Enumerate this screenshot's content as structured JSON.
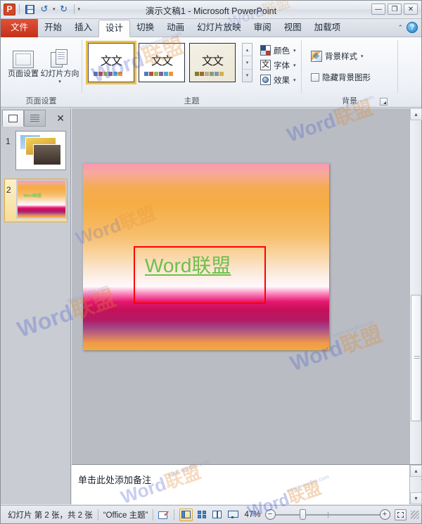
{
  "window": {
    "title": "演示文稿1  -  Microsoft PowerPoint",
    "minimize": "—",
    "maximize": "❐",
    "close": "✕"
  },
  "qat": {
    "logo": "P",
    "save_icon": "save-icon",
    "undo_icon": "undo-icon",
    "redo_icon": "redo-icon",
    "undo_caret": "▾",
    "customize_caret": "▾"
  },
  "tabs": [
    {
      "label": "文件",
      "type": "file"
    },
    {
      "label": "开始",
      "type": "normal"
    },
    {
      "label": "插入",
      "type": "normal"
    },
    {
      "label": "设计",
      "type": "active"
    },
    {
      "label": "切换",
      "type": "normal"
    },
    {
      "label": "动画",
      "type": "normal"
    },
    {
      "label": "幻灯片放映",
      "type": "normal"
    },
    {
      "label": "审阅",
      "type": "normal"
    },
    {
      "label": "视图",
      "type": "normal"
    },
    {
      "label": "加载项",
      "type": "normal"
    }
  ],
  "tab_right": {
    "collapse_caret": "⌃",
    "help": "?"
  },
  "ribbon": {
    "groups": [
      {
        "name": "page_setup",
        "label": "页面设置"
      },
      {
        "name": "themes",
        "label": "主题"
      },
      {
        "name": "background",
        "label": "背景"
      }
    ],
    "page_setup": {
      "buttons": [
        {
          "label": "页面设置",
          "icon": "page-setup-icon"
        },
        {
          "label": "幻灯片方向",
          "icon": "slide-orientation-icon",
          "caret": "▾"
        }
      ]
    },
    "themes": {
      "thumbnails": [
        {
          "text": "文文",
          "selected": true,
          "swatches": [
            "#4a7ebb",
            "#be4b48",
            "#98b954",
            "#7d60a0",
            "#4bacc6",
            "#f0933a"
          ]
        },
        {
          "text": "文文",
          "selected": false,
          "swatches": [
            "#4a7ebb",
            "#be4b48",
            "#98b954",
            "#7d60a0",
            "#4bacc6",
            "#f0933a"
          ]
        },
        {
          "text": "文文",
          "selected": false,
          "swatches": [
            "#837c2c",
            "#9c6a2f",
            "#b8ae8a",
            "#8f9a72",
            "#7f9aa8",
            "#d2b14a"
          ]
        }
      ],
      "scroll_up": "▴",
      "scroll_down": "▾",
      "more": "▾",
      "side_buttons": [
        {
          "label": "颜色",
          "icon": "theme-colors-icon",
          "caret": "▾"
        },
        {
          "label": "字体",
          "icon": "theme-fonts-icon",
          "glyph": "文",
          "caret": "▾"
        },
        {
          "label": "效果",
          "icon": "theme-effects-icon",
          "caret": "▾"
        }
      ]
    },
    "background": {
      "style_button": {
        "label": "背景样式",
        "icon": "background-styles-icon",
        "caret": "▾"
      },
      "hide_graphics": {
        "label": "隐藏背景图形",
        "checked": false
      },
      "launcher": "dialog-launcher-icon"
    }
  },
  "slide_panel": {
    "tabs": [
      {
        "name": "slides-tab",
        "icon": "slide-thumbnail-icon",
        "selected": true
      },
      {
        "name": "outline-tab",
        "icon": "outline-icon",
        "selected": false
      }
    ],
    "close": "✕",
    "slides": [
      {
        "number": "1",
        "active": false,
        "type": "photos"
      },
      {
        "number": "2",
        "active": true,
        "type": "gradient",
        "text": "Word联盟"
      }
    ]
  },
  "slide": {
    "textbox": {
      "text": "Word联盟",
      "text_color": "#6ebf4e",
      "border_color": "#ff0000",
      "underline": true
    },
    "background": {
      "type": "gradient",
      "direction": "vertical",
      "stops": [
        "#f896b0",
        "#f5ad45",
        "#fdf8fb",
        "#c80f5a",
        "#a4478a",
        "#f2a93f"
      ]
    }
  },
  "scrollbar": {
    "up": "▴",
    "down": "▾",
    "prev_slide": "▴",
    "next_slide": "▾"
  },
  "notes": {
    "placeholder": "单击此处添加备注",
    "scroll_up": "▴",
    "scroll_down": "▾"
  },
  "statusbar": {
    "slide_info": "幻灯片 第 2 张，共 2 张",
    "theme_name": "“Office 主题”",
    "spellcheck_icon": "spellcheck-icon",
    "views": [
      {
        "name": "normal-view",
        "selected": true
      },
      {
        "name": "slide-sorter-view",
        "selected": false
      },
      {
        "name": "reading-view",
        "selected": false
      },
      {
        "name": "slideshow-view",
        "selected": false
      }
    ],
    "zoom_level": "47%",
    "zoom_out": "−",
    "zoom_in": "+",
    "fit_button": "fit-to-window-icon"
  },
  "watermarks": {
    "brand_en": "Word",
    "brand_cn": "联盟",
    "url": "www.wordlm.com"
  }
}
